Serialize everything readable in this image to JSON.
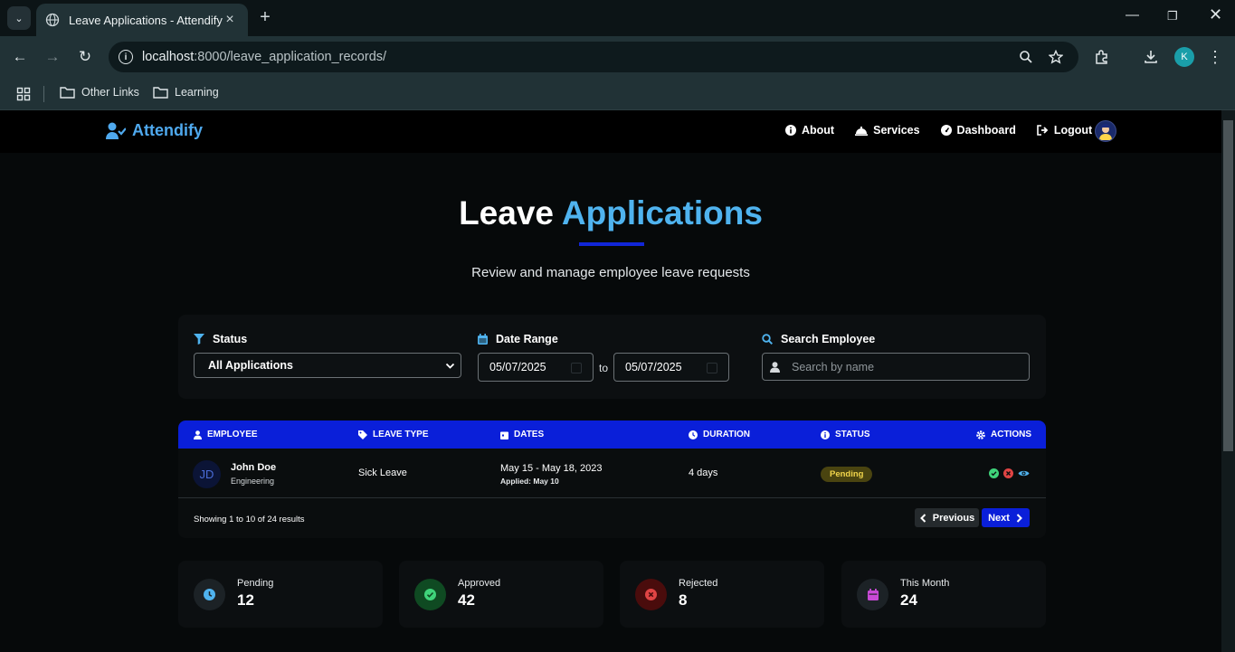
{
  "browser": {
    "tab_title": "Leave Applications - Attendify",
    "url_host": "localhost",
    "url_rest": ":8000/leave_application_records/",
    "profile_initial": "K",
    "bookmarks": [
      "Other Links",
      "Learning"
    ]
  },
  "navbar": {
    "brand": "Attendify",
    "links": [
      {
        "label": "About",
        "icon": "info-circle-icon"
      },
      {
        "label": "Services",
        "icon": "bell-concierge-icon"
      },
      {
        "label": "Dashboard",
        "icon": "gauge-icon"
      },
      {
        "label": "Logout",
        "icon": "sign-out-icon"
      }
    ]
  },
  "hero": {
    "title_plain": "Leave",
    "title_accent": "Applications",
    "subtitle": "Review and manage employee leave requests"
  },
  "filters": {
    "status_label": "Status",
    "status_value": "All Applications",
    "date_label": "Date Range",
    "date_from": "05/07/2025",
    "date_to": "05/07/2025",
    "to_text": "to",
    "search_label": "Search Employee",
    "search_placeholder": "Search by name"
  },
  "table": {
    "headers": [
      "EMPLOYEE",
      "LEAVE TYPE",
      "DATES",
      "DURATION",
      "STATUS",
      "ACTIONS"
    ],
    "rows": [
      {
        "initials": "JD",
        "name": "John Doe",
        "department": "Engineering",
        "leave_type": "Sick Leave",
        "dates": "May 15 - May 18, 2023",
        "applied": "Applied: May 10",
        "duration": "4 days",
        "status": "Pending"
      }
    ],
    "showing": "Showing 1 to 10 of 24 results",
    "prev_label": "Previous",
    "next_label": "Next"
  },
  "stats": [
    {
      "label": "Pending",
      "value": "12",
      "icon": "clock-icon",
      "color": "#4fb3ef"
    },
    {
      "label": "Approved",
      "value": "42",
      "icon": "check-circle-icon",
      "color": "#3fd37a"
    },
    {
      "label": "Rejected",
      "value": "8",
      "icon": "times-circle-icon",
      "color": "#e04444"
    },
    {
      "label": "This Month",
      "value": "24",
      "icon": "calendar-icon",
      "color": "#c84ad6"
    }
  ]
}
